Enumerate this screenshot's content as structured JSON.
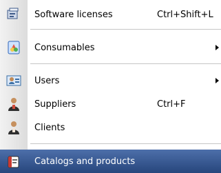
{
  "menu": {
    "items": [
      {
        "label": "Software licenses",
        "shortcut": "Ctrl+Shift+L",
        "icon": "software-licenses-icon"
      },
      {
        "label": "Consumables",
        "shortcut": "",
        "icon": "consumables-icon"
      },
      {
        "label": "Users",
        "shortcut": "",
        "icon": "users-icon"
      },
      {
        "label": "Suppliers",
        "shortcut": "Ctrl+F",
        "icon": "suppliers-icon"
      },
      {
        "label": "Clients",
        "shortcut": "",
        "icon": "clients-icon"
      },
      {
        "label": "Catalogs and products",
        "shortcut": "",
        "icon": "catalogs-products-icon"
      }
    ]
  },
  "colors": {
    "selection_top": "#4d6faa",
    "selection_bottom": "#27467c",
    "gutter": "#e6e6e6"
  }
}
